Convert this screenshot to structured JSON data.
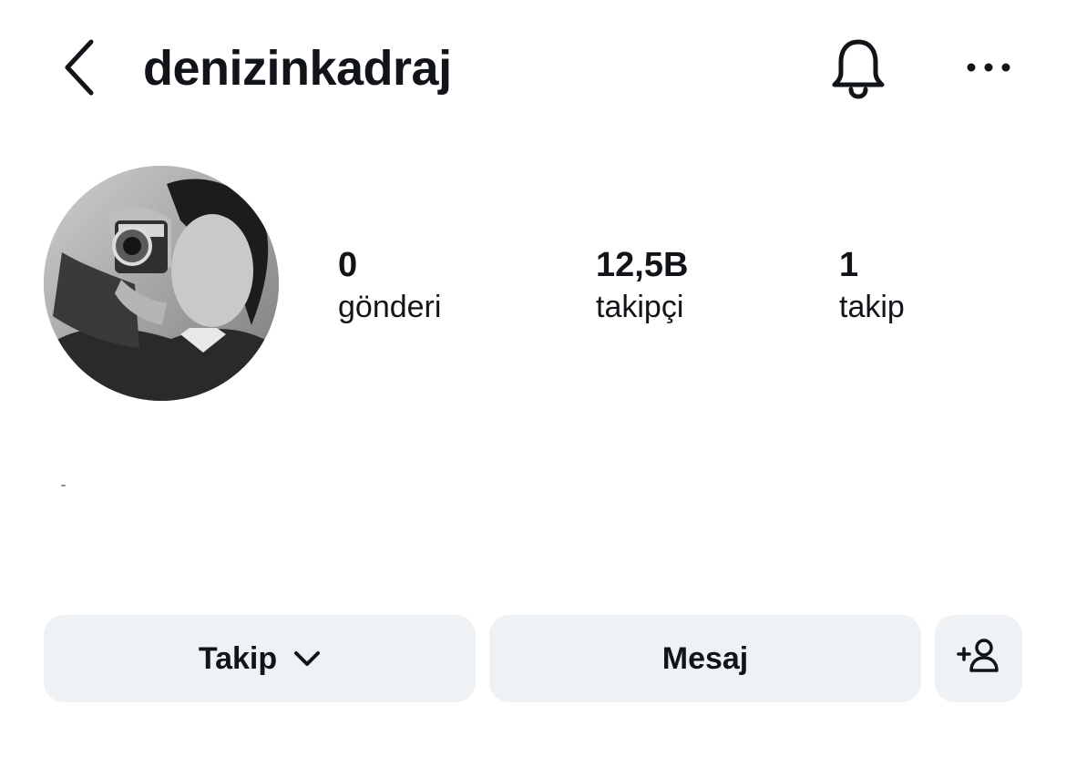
{
  "header": {
    "username": "denizinkadraj",
    "back_icon": "chevron-left-icon",
    "bell_icon": "bell-icon",
    "more_icon": "more-horizontal-icon"
  },
  "profile": {
    "avatar_icon": "profile-photo",
    "stats": [
      {
        "value": "0",
        "label": "gönderi"
      },
      {
        "value": "12,5B",
        "label": "takipçi"
      },
      {
        "value": "1",
        "label": "takip"
      }
    ]
  },
  "actions": {
    "follow_label": "Takip",
    "follow_icon": "chevron-down-icon",
    "message_label": "Mesaj",
    "suggest_icon": "add-person-icon"
  },
  "colors": {
    "text": "#111418",
    "button_bg": "#eff2f5",
    "background": "#ffffff"
  }
}
